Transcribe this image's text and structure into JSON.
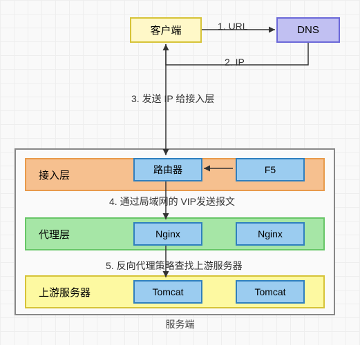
{
  "top": {
    "client": "客户端",
    "dns": "DNS",
    "edge_url": "1. URL",
    "edge_ip": "2. IP"
  },
  "step3": "3. 发送 IP 给接入层",
  "server_label": "服务端",
  "layers": {
    "access": "接入层",
    "proxy": "代理层",
    "upstream": "上游服务器"
  },
  "nodes": {
    "router": "路由器",
    "f5": "F5",
    "nginx1": "Nginx",
    "nginx2": "Nginx",
    "tomcat1": "Tomcat",
    "tomcat2": "Tomcat"
  },
  "step4": "4. 通过局域网的 VIP发送报文",
  "step5": "5. 反向代理策略查找上游服务器"
}
